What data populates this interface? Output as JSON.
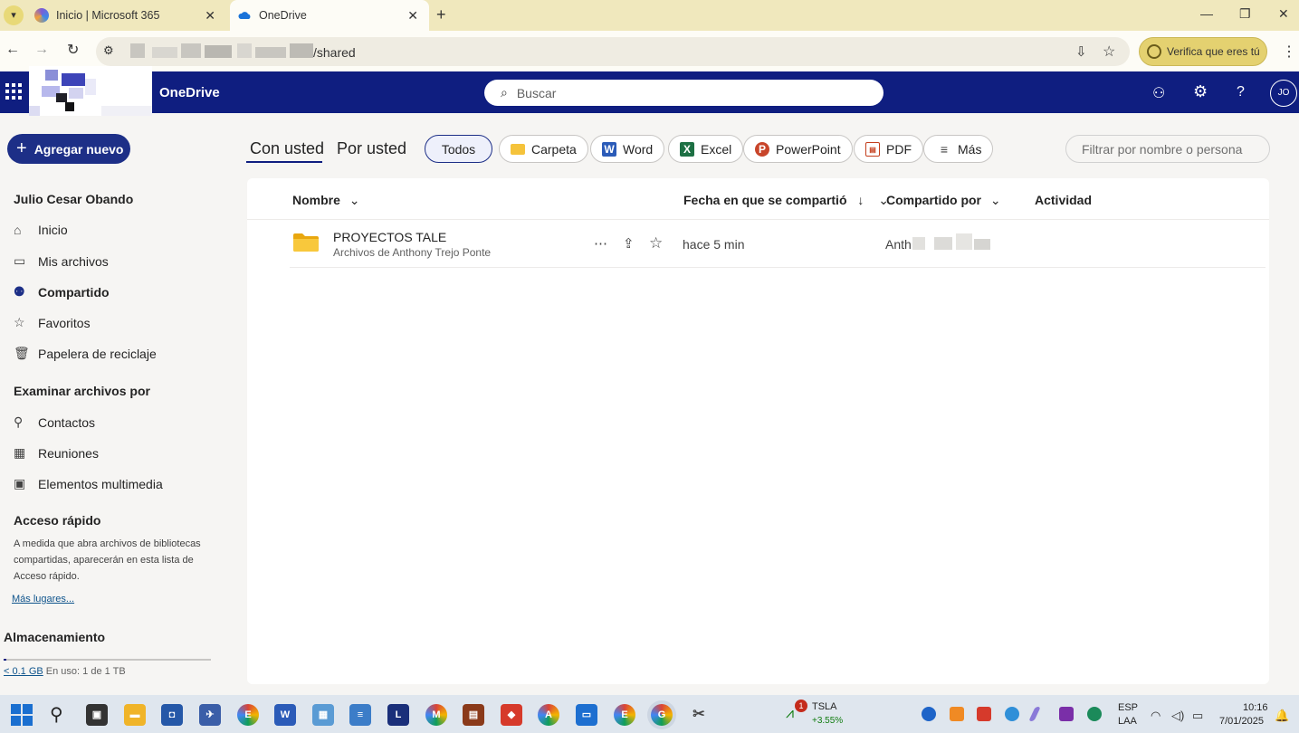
{
  "browser": {
    "tabs": [
      {
        "label": "Inicio | Microsoft 365",
        "favicon": "m365-icon"
      },
      {
        "label": "OneDrive",
        "favicon": "onedrive-icon"
      }
    ],
    "url_visible": "/shared",
    "verify_label": "Verifica que eres tú"
  },
  "header": {
    "app_title": "OneDrive",
    "search_placeholder": "Buscar",
    "avatar_initials": "JO"
  },
  "sidebar": {
    "add_new_label": "Agregar nuevo",
    "user_name": "Julio Cesar Obando",
    "items": [
      {
        "label": "Inicio",
        "icon": "home-icon"
      },
      {
        "label": "Mis archivos",
        "icon": "folder-icon"
      },
      {
        "label": "Compartido",
        "icon": "people-icon"
      },
      {
        "label": "Favoritos",
        "icon": "star-icon"
      },
      {
        "label": "Papelera de reciclaje",
        "icon": "trash-icon"
      }
    ],
    "browse_heading": "Examinar archivos por",
    "browse_items": [
      {
        "label": "Contactos",
        "icon": "person-icon"
      },
      {
        "label": "Reuniones",
        "icon": "calendar-icon"
      },
      {
        "label": "Elementos multimedia",
        "icon": "image-icon"
      }
    ],
    "quick_heading": "Acceso rápido",
    "quick_text": "A medida que abra archivos de bibliotecas compartidas, aparecerán en esta lista de Acceso rápido.",
    "more_places": "Más lugares...",
    "storage_heading": "Almacenamiento",
    "storage_used_link": "< 0.1 GB",
    "storage_text": "En uso: 1 de 1 TB",
    "storage_fraction": 0.0001
  },
  "main": {
    "pivot_tabs": [
      "Con usted",
      "Por usted"
    ],
    "filters": [
      {
        "label": "Todos"
      },
      {
        "label": "Carpeta"
      },
      {
        "label": "Word"
      },
      {
        "label": "Excel"
      },
      {
        "label": "PowerPoint"
      },
      {
        "label": "PDF"
      },
      {
        "label": "Más"
      }
    ],
    "filter_placeholder": "Filtrar por nombre o persona",
    "columns": [
      "Nombre",
      "Fecha en que se compartió",
      "Compartido por",
      "Actividad"
    ],
    "rows": [
      {
        "name": "PROYECTOS TALE",
        "subtitle": "Archivos de Anthony Trejo Ponte",
        "shared_when": "hace 5 min",
        "shared_by": "Anth"
      }
    ]
  },
  "taskbar": {
    "stock_symbol": "TSLA",
    "stock_change": "+3.55%",
    "stock_badge": "1",
    "lang_top": "ESP",
    "lang_bottom": "LAA",
    "time": "10:16",
    "date": "7/01/2025"
  }
}
